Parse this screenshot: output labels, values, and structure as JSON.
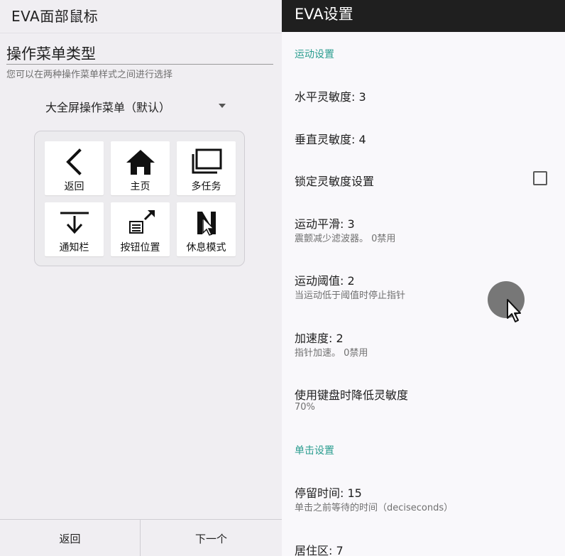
{
  "left": {
    "title": "EVA面部鼠标",
    "section_title": "操作菜单类型",
    "section_desc": "您可以在两种操作菜单样式之间进行选择",
    "dropdown_value": "大全屏操作菜单（默认）",
    "tiles": [
      {
        "label": "返回",
        "icon": "back-chevron-icon"
      },
      {
        "label": "主页",
        "icon": "home-icon"
      },
      {
        "label": "多任务",
        "icon": "multitask-icon"
      },
      {
        "label": "通知栏",
        "icon": "notification-bar-icon"
      },
      {
        "label": "按钮位置",
        "icon": "button-position-icon"
      },
      {
        "label": "休息模式",
        "icon": "rest-mode-icon"
      }
    ],
    "bottom_back": "返回",
    "bottom_next": "下一个"
  },
  "right": {
    "title": "EVA设置",
    "cat_motion": "运动设置",
    "h_sens": "水平灵敏度: 3",
    "v_sens": "垂直灵敏度: 4",
    "lock_sens": "锁定灵敏度设置",
    "lock_checked": false,
    "smooth_title": "运动平滑: 3",
    "smooth_sum": "震颤减少滤波器。 0禁用",
    "threshold_title": "运动阈值: 2",
    "threshold_sum": "当运动低于阈值时停止指针",
    "accel_title": "加速度: 2",
    "accel_sum": "指针加速。 0禁用",
    "kbd_title": "使用键盘时降低灵敏度",
    "kbd_sum": "70%",
    "cat_click": "单击设置",
    "dwell_title": "停留时间: 15",
    "dwell_sum": "单击之前等待的时间（deciseconds）",
    "area_title": "居住区: 7"
  },
  "colors": {
    "accent": "#2a9d8f",
    "header_dark": "#1f1f1f",
    "left_bg": "#f0eef2"
  }
}
